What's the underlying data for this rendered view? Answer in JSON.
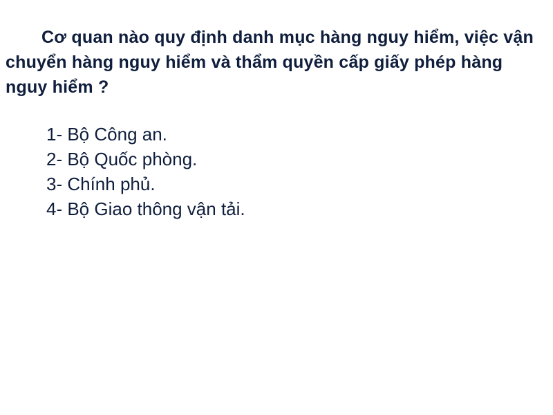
{
  "slide": {
    "question": "Cơ quan nào quy định danh mục hàng nguy hiểm, việc vận chuyển hàng nguy hiểm và thẩm quyền cấp giấy phép hàng nguy hiểm ?",
    "answers": [
      "1- Bộ Công an.",
      "2- Bộ Quốc phòng.",
      "3- Chính phủ.",
      "4- Bộ Giao thông vận tải."
    ]
  },
  "colors": {
    "text": "#0f1e3c",
    "background": "#ffffff"
  }
}
